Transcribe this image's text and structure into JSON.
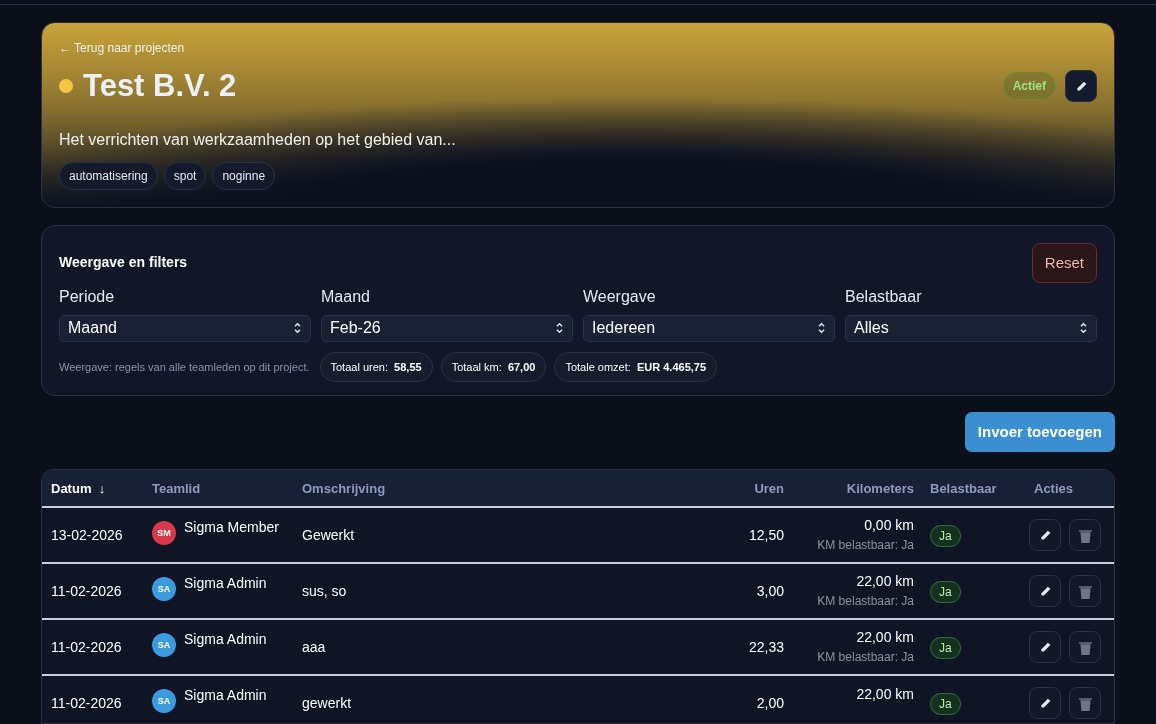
{
  "header": {
    "back_link": "← Terug naar projecten",
    "title": "Test B.V. 2",
    "status": {
      "color": "#f5c542",
      "badge": "Actief"
    },
    "description": "Het verrichten van werkzaamheden op het gebied van...",
    "tags": [
      "automatisering",
      "spot",
      "noginne"
    ]
  },
  "filters": {
    "title": "Weergave en filters",
    "reset_button": "Reset",
    "fields": [
      {
        "label": "Periode",
        "value": "Maand"
      },
      {
        "label": "Maand",
        "value": "Feb-26"
      },
      {
        "label": "Weergave",
        "value": "Iedereen"
      },
      {
        "label": "Belastbaar",
        "value": "Alles"
      }
    ],
    "note": "Weergave: regels van alle teamleden op dit project.",
    "totals": [
      {
        "label": "Totaal uren:",
        "value": "58,55"
      },
      {
        "label": "Totaal km:",
        "value": "67,00"
      },
      {
        "label": "Totale omzet:",
        "value": "EUR 4.465,75"
      }
    ]
  },
  "add_button": "Invoer toevoegen",
  "table": {
    "columns": [
      {
        "label": "Datum",
        "sort": "↓",
        "selected": true
      },
      {
        "label": "Teamlid",
        "selected": false
      },
      {
        "label": "Omschrijving",
        "selected": false
      },
      {
        "label": "Uren",
        "selected": false
      },
      {
        "label": "Kilometers",
        "selected": false
      },
      {
        "label": "Belastbaar",
        "selected": false
      },
      {
        "label": "Acties",
        "selected": false
      }
    ],
    "rows": [
      {
        "date": "13-02-2026",
        "initials": "SM",
        "color": "#d63a4a",
        "member": "Sigma Member",
        "description": "Gewerkt",
        "hours": "12,50",
        "km": "0,00 km",
        "km_note": "KM belastbaar: Ja",
        "taxable": "Ja"
      },
      {
        "date": "11-02-2026",
        "initials": "SA",
        "color": "#3b9be0",
        "member": "Sigma Admin",
        "description": "sus, so",
        "hours": "3,00",
        "km": "22,00 km",
        "km_note": "KM belastbaar: Ja",
        "taxable": "Ja"
      },
      {
        "date": "11-02-2026",
        "initials": "SA",
        "color": "#3b9be0",
        "member": "Sigma Admin",
        "description": "aaa",
        "hours": "22,33",
        "km": "22,00 km",
        "km_note": "KM belastbaar: Ja",
        "taxable": "Ja"
      },
      {
        "date": "11-02-2026",
        "initials": "SA",
        "color": "#3b9be0",
        "member": "Sigma Admin",
        "description": "gewerkt",
        "hours": "2,00",
        "km": "22,00 km",
        "taxable": "Ja"
      }
    ]
  }
}
